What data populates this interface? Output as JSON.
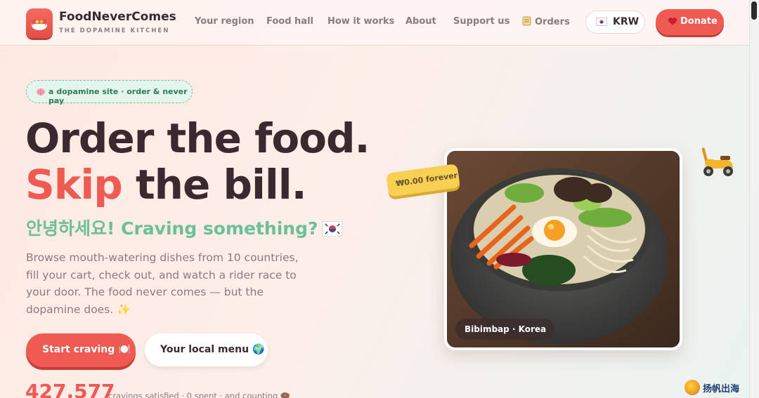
{
  "header": {
    "brand_name": "FoodNeverComes",
    "brand_tagline": "THE DOPAMINE KITCHEN",
    "nav": [
      {
        "label": "Your region"
      },
      {
        "label": "Food hall"
      },
      {
        "label": "How it works"
      },
      {
        "label": "About"
      },
      {
        "label": "Support us"
      },
      {
        "label": "Orders",
        "icon": "scroll-icon"
      }
    ],
    "currency": {
      "flag": "kr-flag-icon",
      "label": "KRW"
    },
    "donate": {
      "icon": "heart-icon",
      "label": "Donate"
    }
  },
  "hero": {
    "badge": {
      "icon": "brain-icon",
      "text": "a dopamine site · order & never pay"
    },
    "headline_line1": "Order the food.",
    "headline_accent": "Skip",
    "headline_line2_rest": " the bill.",
    "greeting": "안녕하세요! Craving something?",
    "description": "Browse mouth-watering dishes from 10 countries, fill your cart, check out, and watch a rider race to your door. The food never comes — but the dopamine does. ✨",
    "primary_cta": "Start craving 🍽️",
    "secondary_cta": "Your local menu 🌍",
    "counter_value": "427,577",
    "counter_text": "cravings satisfied · 0 spent · and counting 🍩"
  },
  "feature": {
    "price_tag": "₩0.00 forever",
    "caption": "Bibimbap · Korea",
    "scooter_icon": "scooter-icon"
  },
  "watermark": "扬帆出海",
  "colors": {
    "accent": "#ef5a52",
    "mint": "#6cc095",
    "text": "#3a2a30",
    "muted": "#8b7b80",
    "price_tag": "#f7cf52"
  }
}
